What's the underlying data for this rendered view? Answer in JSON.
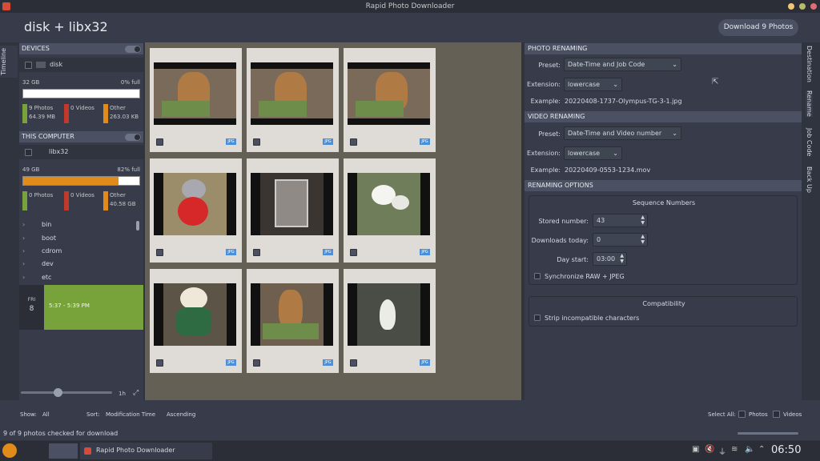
{
  "window": {
    "title": "Rapid Photo Downloader"
  },
  "header": {
    "title": "disk + libx32",
    "download_label": "Download 9 Photos"
  },
  "left_tabs": {
    "timeline": "Timeline"
  },
  "right_tabs": {
    "destination": "Destination",
    "rename": "Rename",
    "job_code": "Job Code",
    "back_up": "Back Up"
  },
  "devices": {
    "header": "DEVICES",
    "name": "disk",
    "capacity": "32 GB",
    "full": "0% full",
    "usage_fraction": 0.0,
    "legend": [
      {
        "label": "9 Photos",
        "value": "64.39 MB",
        "color": "#77a33a"
      },
      {
        "label": "0 Videos",
        "value": "",
        "color": "#c0392b"
      },
      {
        "label": "Other",
        "value": "263.03 KB",
        "color": "#e08b1a"
      }
    ]
  },
  "this_computer": {
    "header": "THIS COMPUTER",
    "name": "libx32",
    "capacity": "49 GB",
    "full": "82% full",
    "usage_fraction": 0.82,
    "legend": [
      {
        "label": "0 Photos",
        "value": "",
        "color": "#77a33a"
      },
      {
        "label": "0 Videos",
        "value": "",
        "color": "#c0392b"
      },
      {
        "label": "Other",
        "value": "40.58 GB",
        "color": "#e08b1a"
      }
    ],
    "tree": [
      "bin",
      "boot",
      "cdrom",
      "dev",
      "etc"
    ]
  },
  "timeline": {
    "day": "FRI",
    "date": "8",
    "range": "5:37 - 5:39 PM",
    "zoom": "1h"
  },
  "thumbnails": [
    {
      "badge": "JPG",
      "subject": "dog-on-chair"
    },
    {
      "badge": "JPG",
      "subject": "dog-on-chair"
    },
    {
      "badge": "JPG",
      "subject": "dog-on-chair"
    },
    {
      "badge": "JPG",
      "subject": "teddy-with-heart"
    },
    {
      "badge": "JPG",
      "subject": "glass-frame"
    },
    {
      "badge": "JPG",
      "subject": "orchid"
    },
    {
      "badge": "JPG",
      "subject": "teddy-bear"
    },
    {
      "badge": "JPG",
      "subject": "dog-on-chair"
    },
    {
      "badge": "JPG",
      "subject": "peace-lily"
    }
  ],
  "photo_renaming": {
    "header": "PHOTO RENAMING",
    "preset_label": "Preset:",
    "preset_value": "Date-Time and Job Code",
    "extension_label": "Extension:",
    "extension_value": "lowercase",
    "example_label": "Example:",
    "example_value": "20220408-1737-Olympus-TG-3-1.jpg"
  },
  "video_renaming": {
    "header": "VIDEO RENAMING",
    "preset_label": "Preset:",
    "preset_value": "Date-Time and Video number",
    "extension_label": "Extension:",
    "extension_value": "lowercase",
    "example_label": "Example:",
    "example_value": "20220409-0553-1234.mov"
  },
  "renaming_options": {
    "header": "RENAMING OPTIONS",
    "sequence_title": "Sequence Numbers",
    "stored_label": "Stored number:",
    "stored_value": "43",
    "downloads_today_label": "Downloads today:",
    "downloads_today_value": "0",
    "day_start_label": "Day start:",
    "day_start_value": "03:00",
    "sync_label": "Synchronize RAW + JPEG",
    "compat_title": "Compatibility",
    "strip_label": "Strip incompatible characters"
  },
  "bottom": {
    "show_label": "Show:",
    "show_value": "All",
    "sort_label": "Sort:",
    "sort_value": "Modification Time",
    "order_value": "Ascending",
    "select_all_label": "Select All:",
    "photos_label": "Photos",
    "videos_label": "Videos",
    "status": "9 of 9 photos checked for download"
  },
  "taskbar": {
    "task_label": "Rapid Photo Downloader",
    "clock": "06:50"
  }
}
